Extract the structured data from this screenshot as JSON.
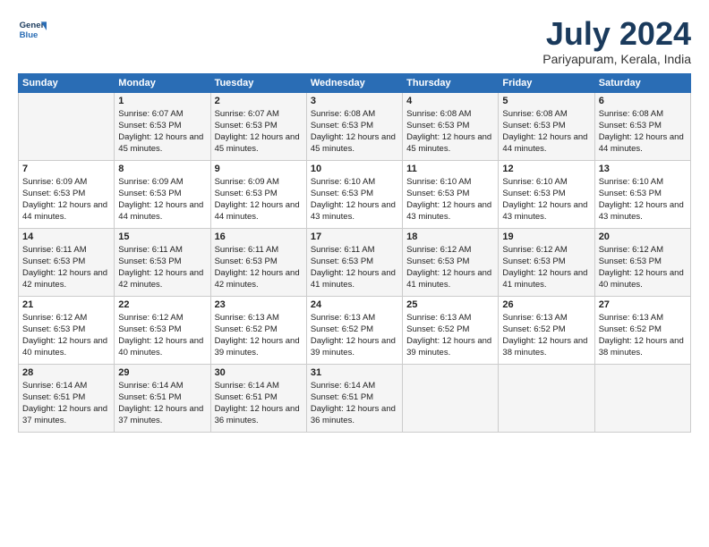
{
  "logo": {
    "line1": "General",
    "line2": "Blue"
  },
  "title": "July 2024",
  "subtitle": "Pariyapuram, Kerala, India",
  "header_days": [
    "Sunday",
    "Monday",
    "Tuesday",
    "Wednesday",
    "Thursday",
    "Friday",
    "Saturday"
  ],
  "weeks": [
    [
      {
        "day": "",
        "sunrise": "",
        "sunset": "",
        "daylight": ""
      },
      {
        "day": "1",
        "sunrise": "Sunrise: 6:07 AM",
        "sunset": "Sunset: 6:53 PM",
        "daylight": "Daylight: 12 hours and 45 minutes."
      },
      {
        "day": "2",
        "sunrise": "Sunrise: 6:07 AM",
        "sunset": "Sunset: 6:53 PM",
        "daylight": "Daylight: 12 hours and 45 minutes."
      },
      {
        "day": "3",
        "sunrise": "Sunrise: 6:08 AM",
        "sunset": "Sunset: 6:53 PM",
        "daylight": "Daylight: 12 hours and 45 minutes."
      },
      {
        "day": "4",
        "sunrise": "Sunrise: 6:08 AM",
        "sunset": "Sunset: 6:53 PM",
        "daylight": "Daylight: 12 hours and 45 minutes."
      },
      {
        "day": "5",
        "sunrise": "Sunrise: 6:08 AM",
        "sunset": "Sunset: 6:53 PM",
        "daylight": "Daylight: 12 hours and 44 minutes."
      },
      {
        "day": "6",
        "sunrise": "Sunrise: 6:08 AM",
        "sunset": "Sunset: 6:53 PM",
        "daylight": "Daylight: 12 hours and 44 minutes."
      }
    ],
    [
      {
        "day": "7",
        "sunrise": "Sunrise: 6:09 AM",
        "sunset": "Sunset: 6:53 PM",
        "daylight": "Daylight: 12 hours and 44 minutes."
      },
      {
        "day": "8",
        "sunrise": "Sunrise: 6:09 AM",
        "sunset": "Sunset: 6:53 PM",
        "daylight": "Daylight: 12 hours and 44 minutes."
      },
      {
        "day": "9",
        "sunrise": "Sunrise: 6:09 AM",
        "sunset": "Sunset: 6:53 PM",
        "daylight": "Daylight: 12 hours and 44 minutes."
      },
      {
        "day": "10",
        "sunrise": "Sunrise: 6:10 AM",
        "sunset": "Sunset: 6:53 PM",
        "daylight": "Daylight: 12 hours and 43 minutes."
      },
      {
        "day": "11",
        "sunrise": "Sunrise: 6:10 AM",
        "sunset": "Sunset: 6:53 PM",
        "daylight": "Daylight: 12 hours and 43 minutes."
      },
      {
        "day": "12",
        "sunrise": "Sunrise: 6:10 AM",
        "sunset": "Sunset: 6:53 PM",
        "daylight": "Daylight: 12 hours and 43 minutes."
      },
      {
        "day": "13",
        "sunrise": "Sunrise: 6:10 AM",
        "sunset": "Sunset: 6:53 PM",
        "daylight": "Daylight: 12 hours and 43 minutes."
      }
    ],
    [
      {
        "day": "14",
        "sunrise": "Sunrise: 6:11 AM",
        "sunset": "Sunset: 6:53 PM",
        "daylight": "Daylight: 12 hours and 42 minutes."
      },
      {
        "day": "15",
        "sunrise": "Sunrise: 6:11 AM",
        "sunset": "Sunset: 6:53 PM",
        "daylight": "Daylight: 12 hours and 42 minutes."
      },
      {
        "day": "16",
        "sunrise": "Sunrise: 6:11 AM",
        "sunset": "Sunset: 6:53 PM",
        "daylight": "Daylight: 12 hours and 42 minutes."
      },
      {
        "day": "17",
        "sunrise": "Sunrise: 6:11 AM",
        "sunset": "Sunset: 6:53 PM",
        "daylight": "Daylight: 12 hours and 41 minutes."
      },
      {
        "day": "18",
        "sunrise": "Sunrise: 6:12 AM",
        "sunset": "Sunset: 6:53 PM",
        "daylight": "Daylight: 12 hours and 41 minutes."
      },
      {
        "day": "19",
        "sunrise": "Sunrise: 6:12 AM",
        "sunset": "Sunset: 6:53 PM",
        "daylight": "Daylight: 12 hours and 41 minutes."
      },
      {
        "day": "20",
        "sunrise": "Sunrise: 6:12 AM",
        "sunset": "Sunset: 6:53 PM",
        "daylight": "Daylight: 12 hours and 40 minutes."
      }
    ],
    [
      {
        "day": "21",
        "sunrise": "Sunrise: 6:12 AM",
        "sunset": "Sunset: 6:53 PM",
        "daylight": "Daylight: 12 hours and 40 minutes."
      },
      {
        "day": "22",
        "sunrise": "Sunrise: 6:12 AM",
        "sunset": "Sunset: 6:53 PM",
        "daylight": "Daylight: 12 hours and 40 minutes."
      },
      {
        "day": "23",
        "sunrise": "Sunrise: 6:13 AM",
        "sunset": "Sunset: 6:52 PM",
        "daylight": "Daylight: 12 hours and 39 minutes."
      },
      {
        "day": "24",
        "sunrise": "Sunrise: 6:13 AM",
        "sunset": "Sunset: 6:52 PM",
        "daylight": "Daylight: 12 hours and 39 minutes."
      },
      {
        "day": "25",
        "sunrise": "Sunrise: 6:13 AM",
        "sunset": "Sunset: 6:52 PM",
        "daylight": "Daylight: 12 hours and 39 minutes."
      },
      {
        "day": "26",
        "sunrise": "Sunrise: 6:13 AM",
        "sunset": "Sunset: 6:52 PM",
        "daylight": "Daylight: 12 hours and 38 minutes."
      },
      {
        "day": "27",
        "sunrise": "Sunrise: 6:13 AM",
        "sunset": "Sunset: 6:52 PM",
        "daylight": "Daylight: 12 hours and 38 minutes."
      }
    ],
    [
      {
        "day": "28",
        "sunrise": "Sunrise: 6:14 AM",
        "sunset": "Sunset: 6:51 PM",
        "daylight": "Daylight: 12 hours and 37 minutes."
      },
      {
        "day": "29",
        "sunrise": "Sunrise: 6:14 AM",
        "sunset": "Sunset: 6:51 PM",
        "daylight": "Daylight: 12 hours and 37 minutes."
      },
      {
        "day": "30",
        "sunrise": "Sunrise: 6:14 AM",
        "sunset": "Sunset: 6:51 PM",
        "daylight": "Daylight: 12 hours and 36 minutes."
      },
      {
        "day": "31",
        "sunrise": "Sunrise: 6:14 AM",
        "sunset": "Sunset: 6:51 PM",
        "daylight": "Daylight: 12 hours and 36 minutes."
      },
      {
        "day": "",
        "sunrise": "",
        "sunset": "",
        "daylight": ""
      },
      {
        "day": "",
        "sunrise": "",
        "sunset": "",
        "daylight": ""
      },
      {
        "day": "",
        "sunrise": "",
        "sunset": "",
        "daylight": ""
      }
    ]
  ]
}
